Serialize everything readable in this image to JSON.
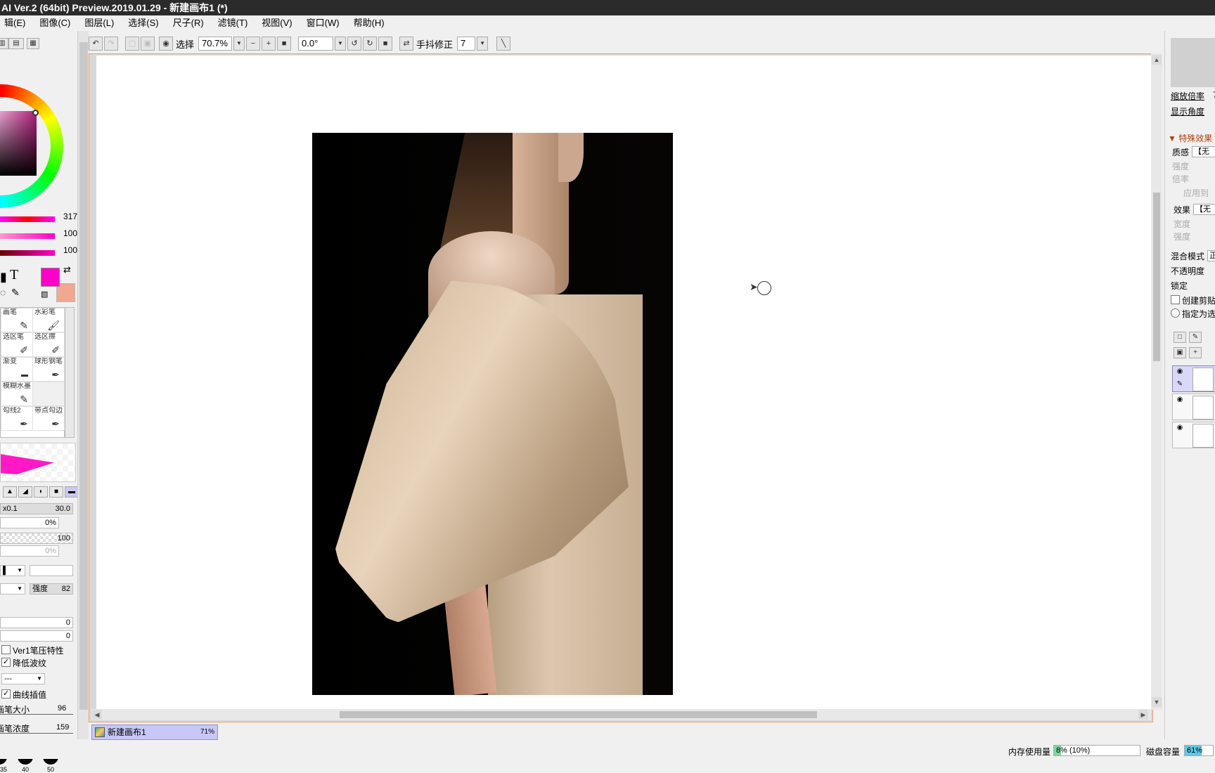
{
  "window": {
    "title": "AI Ver.2 (64bit) Preview.2019.01.29 - 新建画布1 (*)"
  },
  "menu": [
    "辑(E)",
    "图像(C)",
    "图层(L)",
    "选择(S)",
    "尺子(R)",
    "滤镜(T)",
    "视图(V)",
    "窗口(W)",
    "帮助(H)"
  ],
  "color": {
    "hue": "317",
    "saturation": "100",
    "value": "100",
    "main_color": "#ff00c8",
    "sub_color": "#f0a890"
  },
  "tools": [
    {
      "label": "画笔",
      "icon": "brush-icon"
    },
    {
      "label": "水彩笔",
      "icon": "watercolor-brush-icon"
    },
    {
      "label": "选区笔",
      "icon": "selection-pen-icon"
    },
    {
      "label": "选区擦",
      "icon": "selection-eraser-icon"
    },
    {
      "label": "渐变",
      "icon": "gradient-icon"
    },
    {
      "label": "球形钢笔",
      "icon": "pen-icon"
    },
    {
      "label": "模糊水墨",
      "icon": "blur-ink-icon"
    },
    {
      "label": "",
      "icon": ""
    },
    {
      "label": "勾线2",
      "icon": "liner-icon"
    },
    {
      "label": "带点勾边",
      "icon": "dotted-liner-icon"
    }
  ],
  "brush": {
    "size_multiplier": "x0.1",
    "size_value": "30.0",
    "min_size": "0%",
    "density": "100",
    "min_density": "0%",
    "strength_label": "强度",
    "strength_value": "82",
    "field_a": "0",
    "field_b": "0",
    "ver1_pressure_label": "Ver1笔压特性",
    "reduce_wave_label": "降低波纹",
    "dash_select": "---",
    "curve_interp_label": "曲线插值",
    "pen_size_label": "画笔大小",
    "pen_size_value": "96",
    "pen_density_label": "画笔浓度",
    "pen_density_value": "159",
    "dot_sizes": [
      "35",
      "40",
      "50"
    ]
  },
  "toolbar": {
    "select_label": "选择",
    "zoom": "70.7%",
    "angle": "0.0°",
    "stabilizer_label": "手抖修正",
    "stabilizer_value": "7"
  },
  "document": {
    "tab_name": "新建画布1",
    "tab_zoom": "71%"
  },
  "right_panel": {
    "zoom_label": "缩放倍率",
    "zoom_value": "7",
    "angle_label": "显示角度",
    "special_effects": "特殊效果",
    "texture_label": "质感",
    "texture_value": "【无",
    "strength_label": "强度",
    "scale_label": "倍率",
    "apply_label": "应用到",
    "effect_label": "效果",
    "effect_value": "【无",
    "width_label": "宽度",
    "intensity_label": "强度",
    "blend_mode_label": "混合模式",
    "blend_mode_value": "正",
    "opacity_label": "不透明度",
    "lock_label": "锁定",
    "create_clip_label": "创建剪贴",
    "designate_label": "指定为选"
  },
  "status": {
    "memory_label": "内存使用量",
    "memory_value": "8% (10%)",
    "memory_fraction": 0.08,
    "disk_label": "磁盘容量",
    "disk_value": "61%",
    "disk_fraction": 0.61
  }
}
